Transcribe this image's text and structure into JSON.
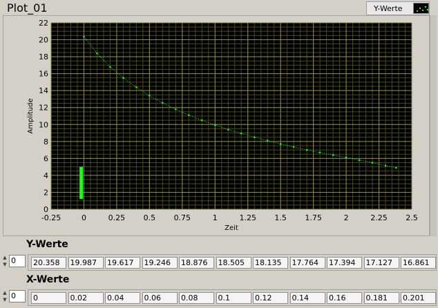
{
  "graph": {
    "title": "Plot_01",
    "legend_label": "Y-Werte",
    "legend_icon": "green-point-plot-icon"
  },
  "colors": {
    "plot_background": "#000000",
    "grid_major": "#8c8c3c",
    "grid_minor": "#4a4a1e",
    "trace": "#1aff1a",
    "panel": "#d4d0c8"
  },
  "chart_data": {
    "type": "scatter",
    "xlabel": "Zeit",
    "ylabel": "Amplitude",
    "xlim": [
      -0.25,
      2.5
    ],
    "ylim": [
      0,
      22
    ],
    "x_ticks": [
      "-0.25",
      "0",
      "0.25",
      "0.5",
      "0.75",
      "1",
      "1.25",
      "1.5",
      "1.75",
      "2",
      "2.25",
      "2.5"
    ],
    "y_ticks": [
      "0",
      "2",
      "4",
      "6",
      "8",
      "10",
      "12",
      "14",
      "16",
      "18",
      "20",
      "22"
    ],
    "grid": true,
    "series": [
      {
        "x": [
          0,
          0.1,
          0.2,
          0.3,
          0.4,
          0.5,
          0.6,
          0.7,
          0.8,
          0.9,
          1.0,
          1.1,
          1.2,
          1.3,
          1.4,
          1.5,
          1.6,
          1.7,
          1.8,
          1.9,
          2.0,
          2.1,
          2.2,
          2.3,
          2.38
        ],
        "y": [
          20.36,
          18.4,
          16.8,
          15.5,
          14.4,
          13.4,
          12.55,
          11.8,
          11.1,
          10.5,
          9.95,
          9.4,
          8.95,
          8.5,
          8.1,
          7.7,
          7.35,
          7.0,
          6.7,
          6.4,
          6.1,
          5.8,
          5.5,
          5.15,
          4.9
        ]
      },
      {
        "x": [
          -0.02,
          -0.02
        ],
        "y": [
          1.2,
          5.0
        ]
      }
    ]
  },
  "y_array": {
    "label": "Y-Werte",
    "index": "0",
    "values": [
      "20.358",
      "19.987",
      "19.617",
      "19.246",
      "18.876",
      "18.505",
      "18.135",
      "17.764",
      "17.394",
      "17.127",
      "16.861"
    ]
  },
  "x_array": {
    "label": "X-Werte",
    "index": "0",
    "values": [
      "0",
      "0.02",
      "0.04",
      "0.06",
      "0.08",
      "0.1",
      "0.12",
      "0.14",
      "0.16",
      "0.181",
      "0.201"
    ]
  }
}
